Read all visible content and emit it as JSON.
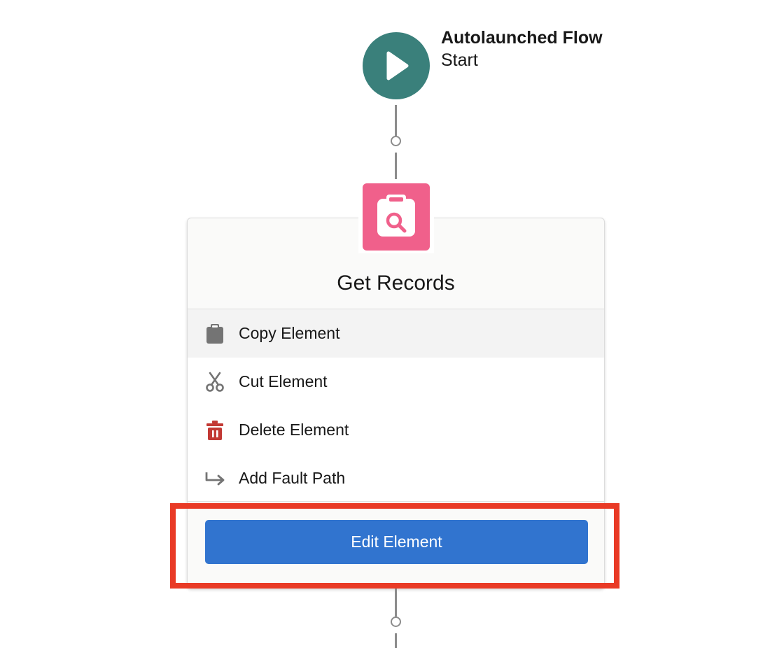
{
  "start_node": {
    "title": "Autolaunched Flow",
    "subtitle": "Start",
    "icon": "play-icon",
    "color": "#3a807b"
  },
  "element": {
    "title": "Get Records",
    "icon": "clipboard-search-icon",
    "icon_color": "#f0608b"
  },
  "menu": {
    "items": [
      {
        "label": "Copy Element",
        "icon": "clipboard-icon"
      },
      {
        "label": "Cut Element",
        "icon": "scissors-icon"
      },
      {
        "label": "Delete Element",
        "icon": "trash-icon",
        "icon_color": "#c23934"
      },
      {
        "label": "Add Fault Path",
        "icon": "fault-path-arrow-icon"
      }
    ],
    "edit_button_label": "Edit Element",
    "edit_button_color": "#3174cf"
  },
  "annotation": {
    "highlight_color": "#e93a26"
  }
}
